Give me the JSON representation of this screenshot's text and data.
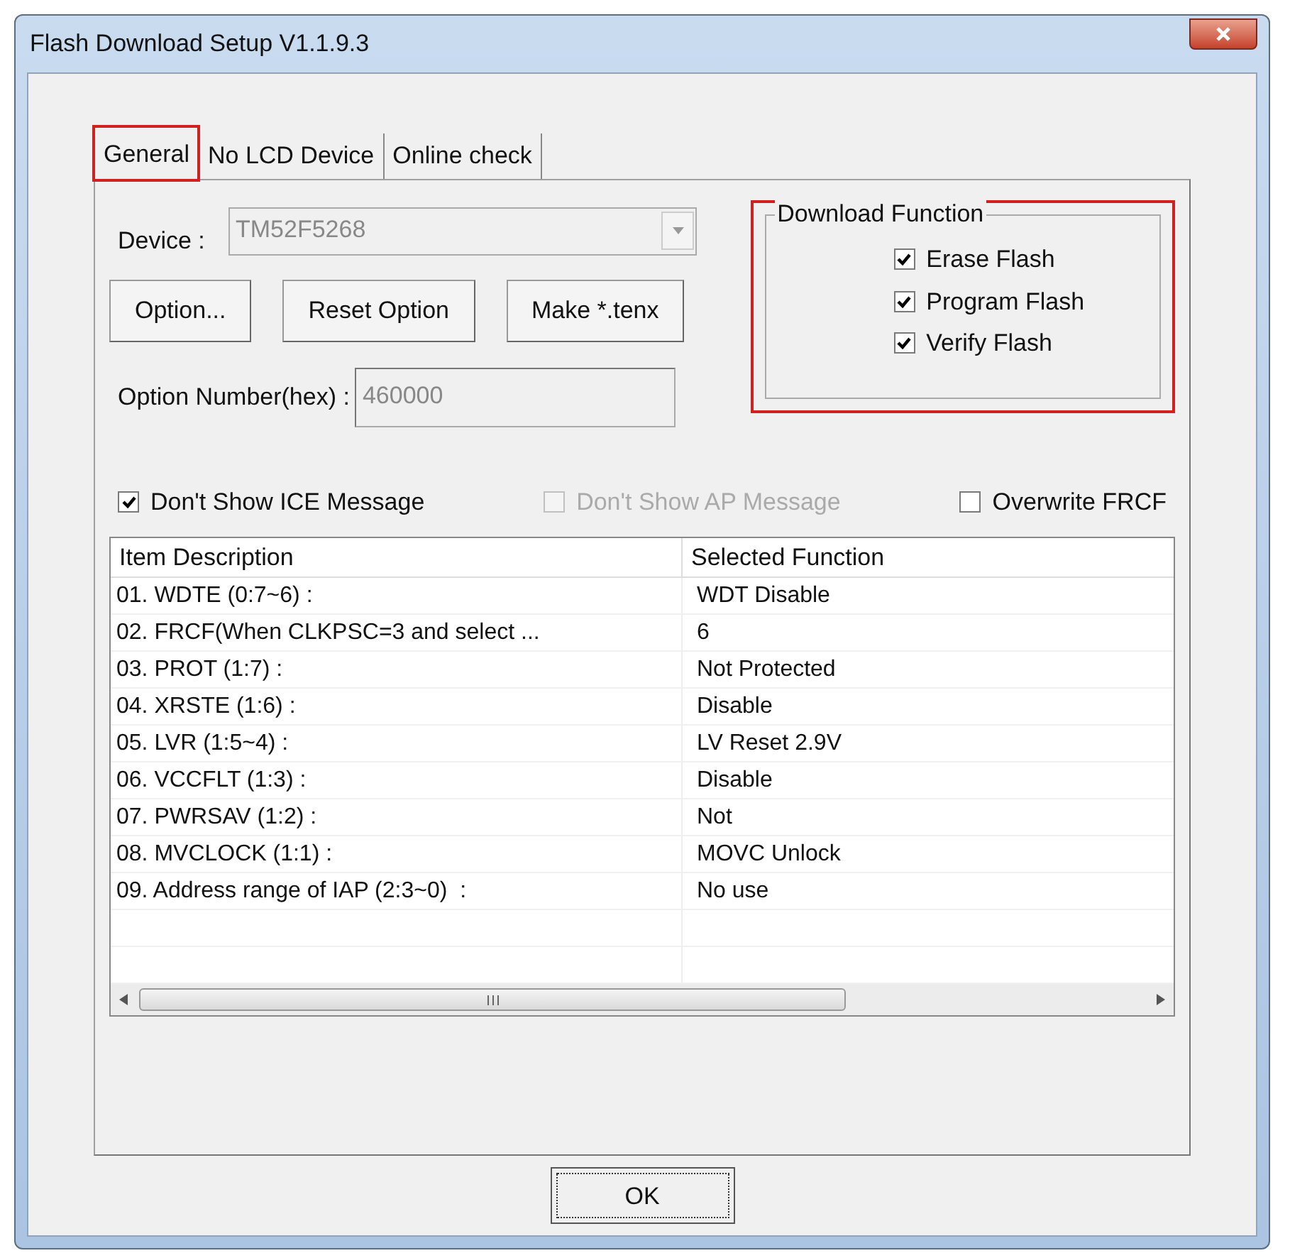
{
  "window": {
    "title": "Flash Download Setup V1.1.9.3"
  },
  "tabs": [
    {
      "label": "General",
      "selected": true,
      "highlighted": true
    },
    {
      "label": "No LCD Device",
      "selected": false,
      "highlighted": false
    },
    {
      "label": "Online check",
      "selected": false,
      "highlighted": false
    }
  ],
  "device": {
    "label": "Device :",
    "value": "TM52F5268",
    "disabled": true
  },
  "buttons": [
    "Option...",
    "Reset Option",
    "Make *.tenx"
  ],
  "download_function": {
    "title": "Download Function",
    "highlighted": true,
    "items": [
      {
        "label": "Erase Flash",
        "checked": true
      },
      {
        "label": "Program Flash",
        "checked": true
      },
      {
        "label": "Verify Flash",
        "checked": true
      }
    ]
  },
  "option_number": {
    "label": "Option Number(hex) :",
    "value": "460000",
    "disabled": true
  },
  "options": [
    {
      "label": "Don't Show ICE Message",
      "checked": true,
      "disabled": false
    },
    {
      "label": "Don't Show AP Message",
      "checked": false,
      "disabled": true
    },
    {
      "label": "Overwrite FRCF",
      "checked": false,
      "disabled": false
    }
  ],
  "table": {
    "columns": [
      "Item Description",
      "Selected Function"
    ],
    "rows": [
      [
        "01. WDTE (0:7~6) :",
        "WDT Disable"
      ],
      [
        "02. FRCF(When CLKPSC=3 and select ...",
        "6"
      ],
      [
        "03. PROT (1:7) :",
        "Not Protected"
      ],
      [
        "04. XRSTE (1:6) :",
        "Disable"
      ],
      [
        "05. LVR (1:5~4) :",
        "LV Reset 2.9V"
      ],
      [
        "06. VCCFLT (1:3) :",
        "Disable"
      ],
      [
        "07. PWRSAV (1:2) :",
        "Not"
      ],
      [
        "08. MVCLOCK (1:1) :",
        "MOVC Unlock"
      ],
      [
        "09. Address range of IAP (2:3~0)  :",
        "No use"
      ]
    ]
  },
  "ok_button": "OK"
}
